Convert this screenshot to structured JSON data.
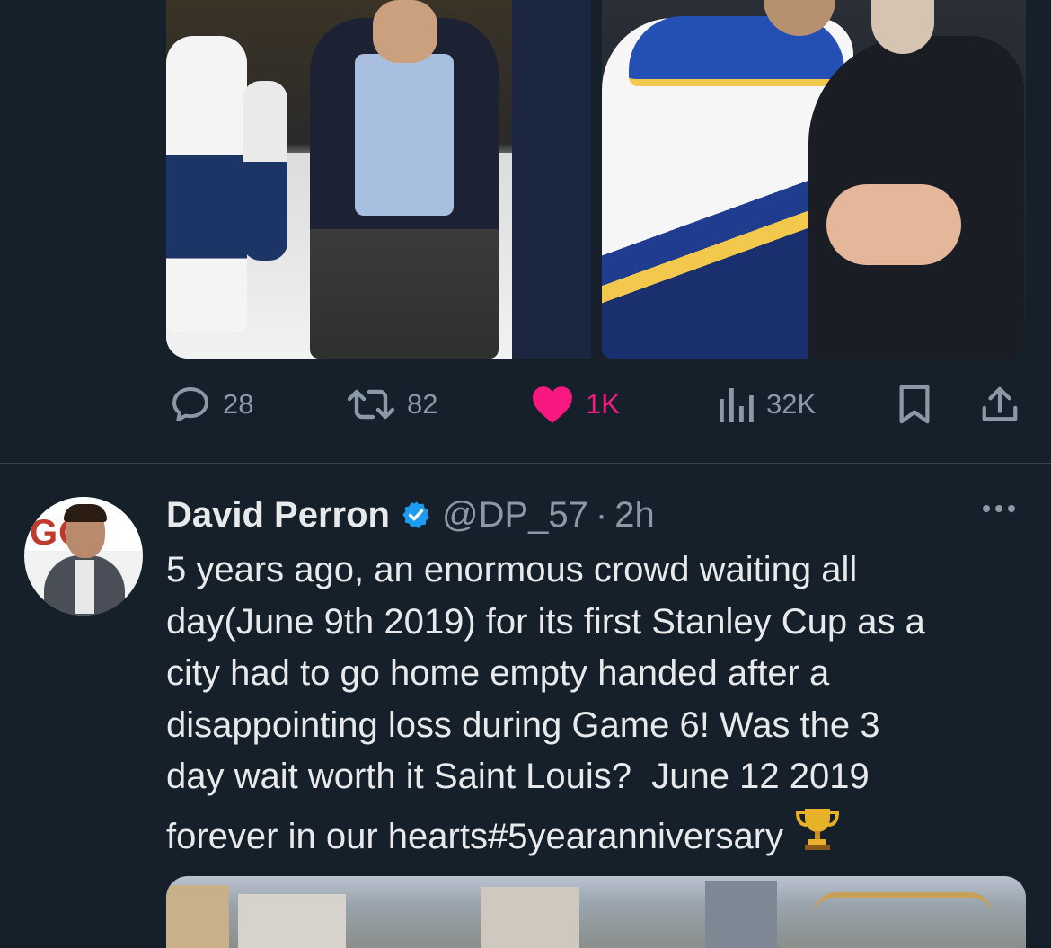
{
  "tweet_top": {
    "media": {
      "left_alt": "photo",
      "right_alt": "photo"
    },
    "actions": {
      "reply_count": "28",
      "retweet_count": "82",
      "like_count": "1K",
      "views_count": "32K",
      "liked": true,
      "like_color": "#f91880"
    }
  },
  "tweet": {
    "author_name": "David Perron",
    "verified": true,
    "verified_color": "#1d9bf0",
    "handle": "@DP_57",
    "separator": "·",
    "time": "2h",
    "avatar_text": "GO",
    "text": "5 years ago, an enormous crowd waiting all\nday(June 9th 2019) for its first Stanley Cup as a\ncity had to go home empty handed after a\ndisappointing loss during Game 6! Was the 3\nday wait worth it Saint Louis?  June 12 2019\nforever in our hearts#5yearanniversary",
    "emoji": "trophy"
  },
  "colors": {
    "background": "#15202b",
    "text_primary": "#e7e9ea",
    "text_secondary": "#8b98a5",
    "divider": "#38444d"
  }
}
